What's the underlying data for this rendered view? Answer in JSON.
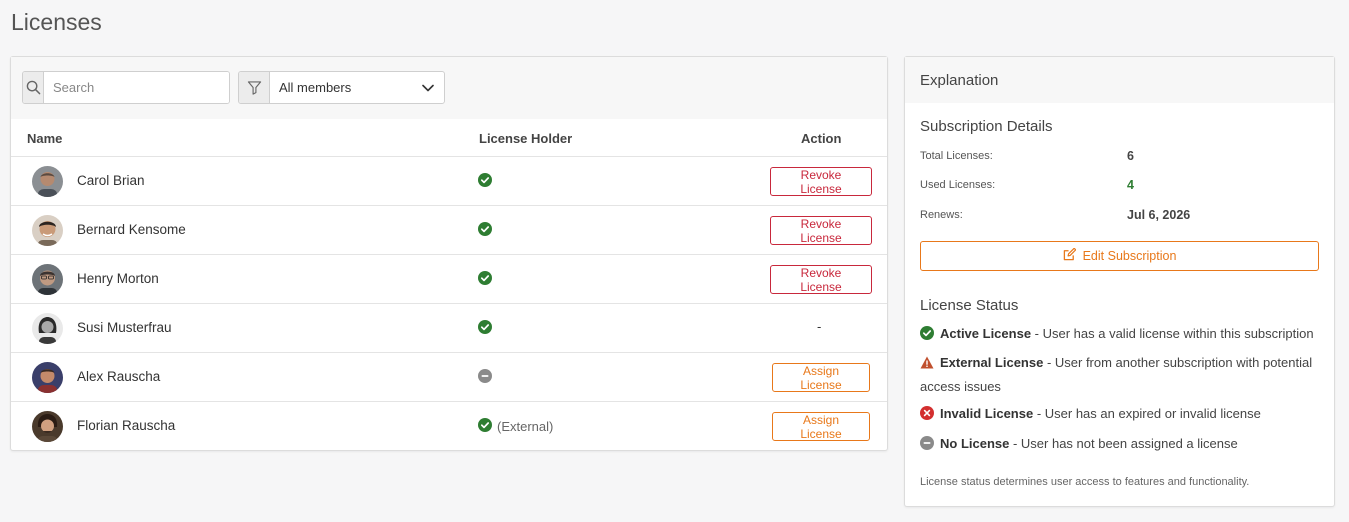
{
  "page": {
    "title": "Licenses"
  },
  "toolbar": {
    "search_placeholder": "Search",
    "filter_value": "All members"
  },
  "table": {
    "headers": {
      "name": "Name",
      "holder": "License Holder",
      "action": "Action"
    },
    "rows": [
      {
        "name": "Carol Brian",
        "status": "active",
        "external_text": "",
        "action": "Revoke License"
      },
      {
        "name": "Bernard Kensome",
        "status": "active",
        "external_text": "",
        "action": "Revoke License"
      },
      {
        "name": "Henry Morton",
        "status": "active",
        "external_text": "",
        "action": "Revoke License"
      },
      {
        "name": "Susi Musterfrau",
        "status": "active",
        "external_text": "",
        "action": "-"
      },
      {
        "name": "Alex Rauscha",
        "status": "none",
        "external_text": "",
        "action": "Assign License"
      },
      {
        "name": "Florian Rauscha",
        "status": "active",
        "external_text": "(External)",
        "action": "Assign License"
      }
    ]
  },
  "explanation": {
    "title": "Explanation",
    "subscription": {
      "title": "Subscription Details",
      "total_label": "Total Licenses:",
      "total_value": "6",
      "used_label": "Used Licenses:",
      "used_value": "4",
      "renews_label": "Renews:",
      "renews_value": "Jul 6, 2026",
      "edit_button": "Edit Subscription"
    },
    "status": {
      "title": "License Status",
      "active_name": "Active License",
      "active_desc": " - User has a valid license within this subscription",
      "external_name": "External License",
      "external_desc": " - User from another subscription with potential access issues",
      "invalid_name": "Invalid License",
      "invalid_desc": " - User has an expired or invalid license",
      "none_name": "No License",
      "none_desc": " - User has not been assigned a license"
    },
    "footnote": "License status determines user access to features and functionality."
  },
  "colors": {
    "active": "#2e7d32",
    "none": "#8a8a8a",
    "external": "#c0502e",
    "invalid": "#d32f2f",
    "revoke": "#c8283c",
    "assign": "#e8781a"
  }
}
